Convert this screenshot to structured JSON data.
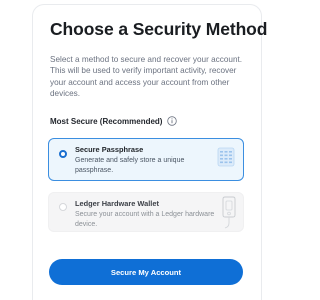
{
  "header": {
    "title": "Choose a Security Method",
    "description": "Select a method to secure and recover your account. This will be used to verify important activity, recover your account and access your account from other devices."
  },
  "section": {
    "label": "Most Secure (Recommended)",
    "info_icon": "info-icon"
  },
  "options": [
    {
      "title": "Secure Passphrase",
      "description": "Generate and safely store a unique passphrase.",
      "selected": true,
      "icon": "passphrase-grid-icon"
    },
    {
      "title": "Ledger Hardware Wallet",
      "description": "Secure your account with a Ledger hardware device.",
      "selected": false,
      "icon": "ledger-device-icon"
    }
  ],
  "actions": {
    "primary_label": "Secure My Account"
  },
  "colors": {
    "accent": "#0f6fd6",
    "selected_border": "#3b8ee0",
    "selected_background": "#edf6fd",
    "unselected_background": "#f5f5f6"
  }
}
